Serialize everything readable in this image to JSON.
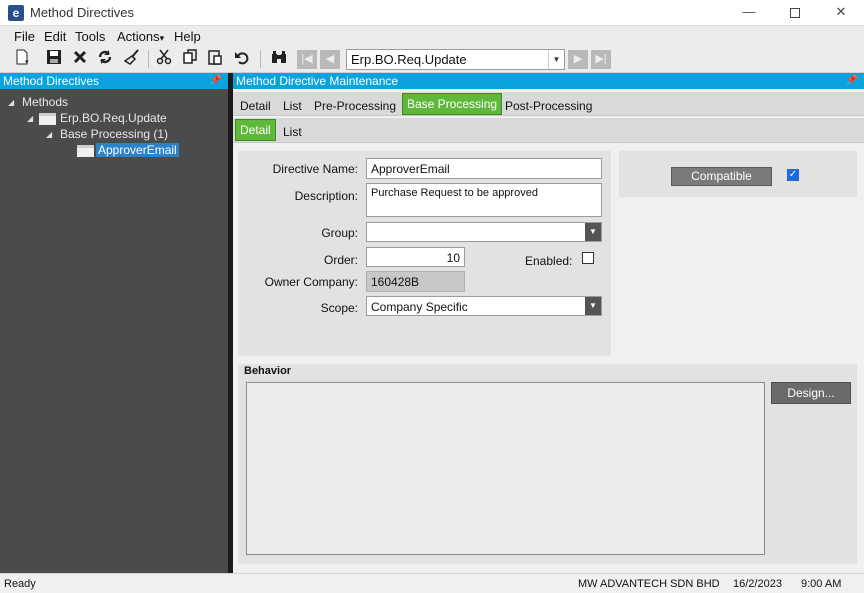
{
  "window": {
    "title": "Method Directives",
    "app_icon_letter": "e",
    "minimize_glyph": "—",
    "close_glyph": "✕"
  },
  "menu": [
    "File",
    "Edit",
    "Tools",
    "Actions",
    "Help"
  ],
  "actions_caret": "▾",
  "toolbar": {
    "icons": [
      "new-icon",
      "save-icon",
      "delete-icon",
      "refresh-icon",
      "clear-icon",
      "cut-icon",
      "copy-icon",
      "paste-icon",
      "undo-icon",
      "search-icon",
      "first-record-icon",
      "previous-record-icon",
      "next-record-icon",
      "last-record-icon"
    ],
    "method_combo_value": "Erp.BO.Req.Update"
  },
  "left_panel": {
    "header": "Method Directives",
    "tree": {
      "root": "Methods",
      "method": "Erp.BO.Req.Update",
      "group": "Base Processing (1)",
      "selected": "ApproverEmail"
    }
  },
  "right_panel": {
    "header": "Method Directive Maintenance",
    "tabs": [
      "Detail",
      "List",
      "Pre-Processing",
      "Base Processing",
      "Post-Processing"
    ],
    "active_tab": "Base Processing",
    "subtabs": [
      "Detail",
      "List"
    ],
    "active_subtab": "Detail"
  },
  "form": {
    "directive_name_label": "Directive Name:",
    "directive_name_value": "ApproverEmail",
    "description_label": "Description:",
    "description_value": "Purchase Request to be approved",
    "group_label": "Group:",
    "group_value": "",
    "order_label": "Order:",
    "order_value": "10",
    "enabled_label": "Enabled:",
    "enabled": false,
    "owner_company_label": "Owner Company:",
    "owner_company_value": "160428B",
    "scope_label": "Scope:",
    "scope_value": "Company Specific"
  },
  "compat": {
    "button_label": "Compatible",
    "checked": true
  },
  "behavior": {
    "title": "Behavior",
    "design_button_label": "Design..."
  },
  "status": {
    "text": "Ready",
    "company": "MW ADVANTECH SDN BHD",
    "date": "16/2/2023",
    "time": "9:00 AM"
  },
  "colors": {
    "accent": "#0aa3dd",
    "tab_active": "#5fb83a",
    "left_panel_bg": "#4b4b4b"
  }
}
